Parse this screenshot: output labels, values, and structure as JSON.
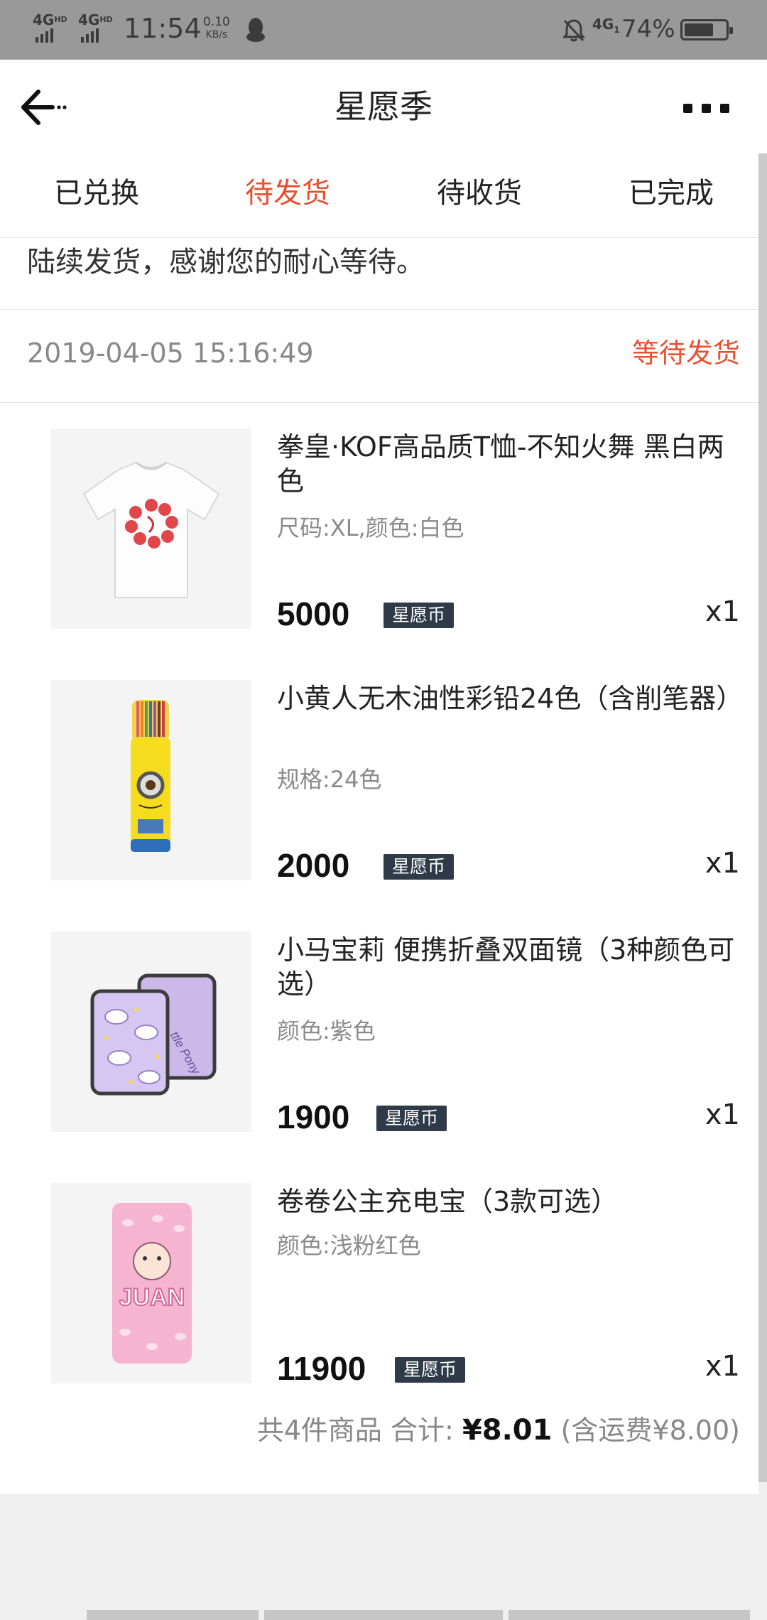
{
  "status_bar": {
    "network1": "4G",
    "network1_sup": "HD",
    "network2": "4G",
    "network2_sup": "HD",
    "time": "11:54",
    "speed_value": "0.10",
    "speed_unit": "KB/s",
    "qq_icon": "qq-penguin-icon",
    "mute_icon": "bell-off-icon",
    "network3": "4G",
    "network3_sub": "1",
    "battery_percent": "74%",
    "battery_level": 0.74
  },
  "header": {
    "title": "星愿季",
    "back_icon": "arrow-left-icon",
    "more_icon": "more-dots-icon"
  },
  "tabs": [
    {
      "label": "已兑换",
      "active": false
    },
    {
      "label": "待发货",
      "active": true
    },
    {
      "label": "待收货",
      "active": false
    },
    {
      "label": "已完成",
      "active": false
    }
  ],
  "order": {
    "notice": "陆续发货，感谢您的耐心等待。",
    "datetime": "2019-04-05 15:16:49",
    "status": "等待发货",
    "products": [
      {
        "name": "拳皇·KOF高品质T恤-不知火舞 黑白两色",
        "spec": "尺码:XL,颜色:白色",
        "price": "5000",
        "currency": "星愿币",
        "qty": "x1",
        "image": "white-tshirt-image"
      },
      {
        "name": "小黄人无木油性彩铅24色（含削笔器）",
        "spec": "规格:24色",
        "price": "2000",
        "currency": "星愿币",
        "qty": "x1",
        "image": "minion-pencil-tube-image"
      },
      {
        "name": "小马宝莉 便携折叠双面镜（3种颜色可选）",
        "spec": "颜色:紫色",
        "price": "1900",
        "currency": "星愿币",
        "qty": "x1",
        "image": "pony-mirror-image"
      },
      {
        "name": "卷卷公主充电宝（3款可选）",
        "spec": "颜色:浅粉红色",
        "price": "11900",
        "currency": "星愿币",
        "qty": "x1",
        "image": "pink-powerbank-image"
      }
    ],
    "summary": {
      "count_text": "共4件商品",
      "total_label": "合计:",
      "total_value": "¥8.01",
      "shipping_text": "(含运费¥8.00)"
    }
  },
  "colors": {
    "accent": "#e8502f",
    "status_bar_bg": "#999999",
    "coin_badge_bg": "#2e3a47"
  }
}
